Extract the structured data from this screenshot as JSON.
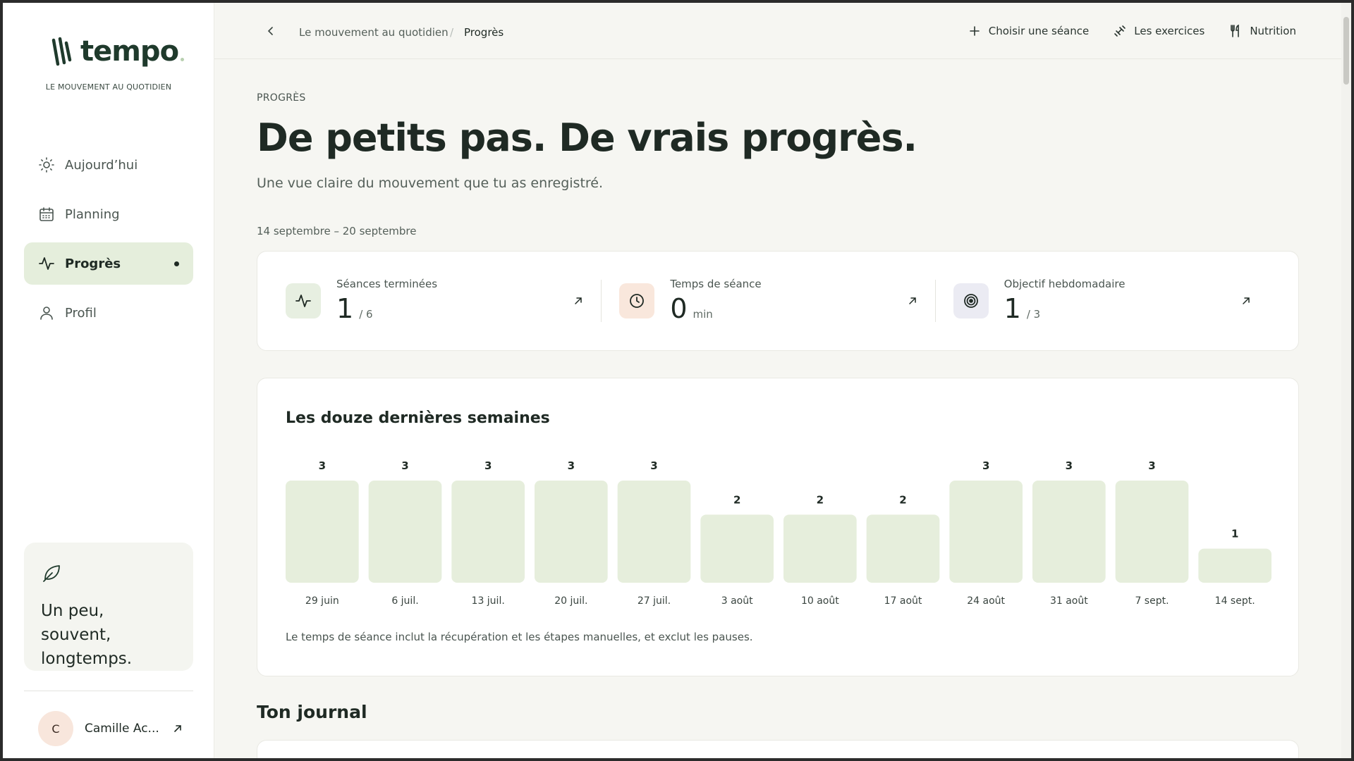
{
  "brand": {
    "name": "tempo",
    "tagline": "LE MOUVEMENT AU QUOTIDIEN"
  },
  "nav": {
    "items": [
      {
        "label": "Aujourd’hui",
        "icon": "sun-icon"
      },
      {
        "label": "Planning",
        "icon": "calendar-icon"
      },
      {
        "label": "Progrès",
        "icon": "activity-icon",
        "active": true
      },
      {
        "label": "Profil",
        "icon": "user-icon"
      }
    ]
  },
  "quote": {
    "text": "Un peu, souvent, longtemps."
  },
  "user": {
    "initial": "C",
    "name": "Camille Ac..."
  },
  "breadcrumb": {
    "parent": "Le mouvement au quotidien",
    "separator": "/",
    "current": "Progrès"
  },
  "actions": {
    "choose_session": "Choisir une séance",
    "exercises": "Les exercices",
    "nutrition": "Nutrition"
  },
  "page": {
    "eyebrow": "PROGRÈS",
    "title": "De petits pas. De vrais progrès.",
    "subtitle": "Une vue claire du mouvement que tu as enregistré.",
    "date_range": "14 septembre – 20 septembre"
  },
  "stats": [
    {
      "label": "Séances terminées",
      "value": "1",
      "unit": "/ 6",
      "icon": "activity-icon",
      "color": "#e7efe1"
    },
    {
      "label": "Temps de séance",
      "value": "0",
      "unit": "min",
      "icon": "clock-icon",
      "color": "#f9e7dc"
    },
    {
      "label": "Objectif hebdomadaire",
      "value": "1",
      "unit": "/ 3",
      "icon": "target-icon",
      "color": "#ebebf3"
    }
  ],
  "chart": {
    "title": "Les douze dernières semaines",
    "note": "Le temps de séance inclut la récupération et les étapes manuelles, et exclut les pauses."
  },
  "chart_data": {
    "type": "bar",
    "categories": [
      "29 juin",
      "6 juil.",
      "13 juil.",
      "20 juil.",
      "27 juil.",
      "3 août",
      "10 août",
      "17 août",
      "24 août",
      "31 août",
      "7 sept.",
      "14 sept."
    ],
    "values": [
      3,
      3,
      3,
      3,
      3,
      2,
      2,
      2,
      3,
      3,
      3,
      1
    ],
    "ylim": [
      0,
      3
    ],
    "bar_color": "#e6eedc",
    "grid": false
  },
  "journal": {
    "title": "Ton journal"
  },
  "colors": {
    "accent": "#1f3a2c",
    "active_bg": "#e5eedc"
  }
}
